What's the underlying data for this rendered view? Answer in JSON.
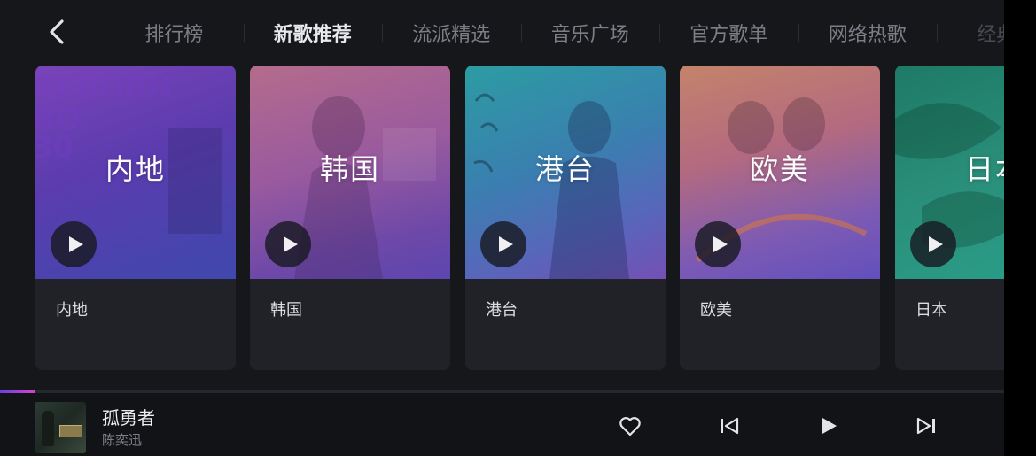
{
  "nav": {
    "back_icon": "chevron-left-icon",
    "tabs": [
      {
        "label": "排行榜"
      },
      {
        "label": "新歌推荐"
      },
      {
        "label": "流派精选"
      },
      {
        "label": "音乐广场"
      },
      {
        "label": "官方歌单"
      },
      {
        "label": "网络热歌"
      },
      {
        "label": "经典老"
      }
    ],
    "active_tab": "新歌推荐"
  },
  "cards": [
    {
      "cover_title": "内地",
      "label": "内地"
    },
    {
      "cover_title": "韩国",
      "label": "韩国"
    },
    {
      "cover_title": "港台",
      "label": "港台"
    },
    {
      "cover_title": "欧美",
      "label": "欧美"
    },
    {
      "cover_title": "日本",
      "label": "日本"
    }
  ],
  "player": {
    "song_title": "孤勇者",
    "artist": "陈奕迅",
    "progress": 0.034,
    "icons": [
      "heart-icon",
      "skip-previous-icon",
      "play-icon",
      "skip-next-icon"
    ]
  },
  "colors": {
    "background": "#16171b",
    "accent_start": "#6d3ee0",
    "accent_end": "#d145c9"
  }
}
